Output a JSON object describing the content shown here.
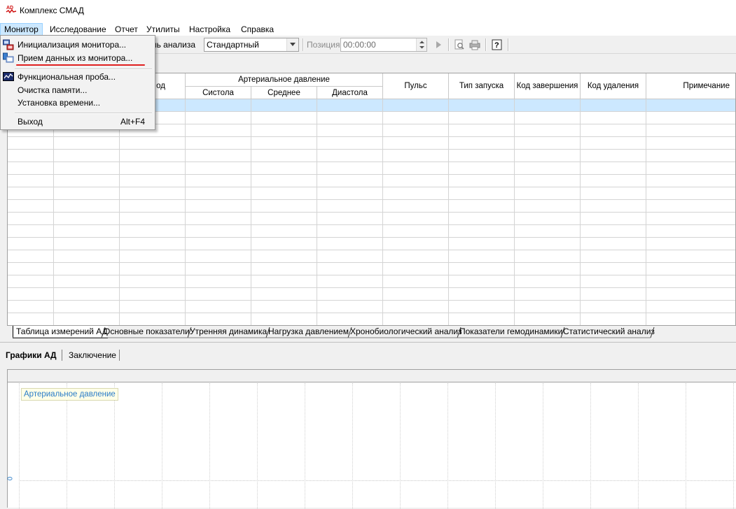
{
  "window": {
    "title": "Комплекс СМАД"
  },
  "menubar": {
    "items": [
      {
        "label": "Монитор"
      },
      {
        "label": "Исследование"
      },
      {
        "label": "Отчет"
      },
      {
        "label": "Утилиты"
      },
      {
        "label": "Настройка"
      },
      {
        "label": "Справка"
      }
    ]
  },
  "dropdown": {
    "items": [
      {
        "label": "Инициализация монитора..."
      },
      {
        "label": "Прием данных из монитора..."
      },
      {
        "label": "Функциональная проба..."
      },
      {
        "label": "Очистка памяти..."
      },
      {
        "label": "Установка времени..."
      },
      {
        "label": "Выход",
        "shortcut": "Alt+F4"
      }
    ]
  },
  "toolbar": {
    "profile_label": "филь анализа",
    "profile_value": "Стандартный",
    "position_label": "Позиция",
    "position_value": "00:00:00"
  },
  "table": {
    "headers": {
      "time_partial": "од",
      "bp_group": "Артериальное давление",
      "systole": "Систола",
      "mean": "Среднее",
      "diastole": "Диастола",
      "pulse": "Пульс",
      "start_type": "Тип запуска",
      "completion_code": "Код завершения",
      "deletion_code": "Код удаления",
      "note": "Примечание"
    }
  },
  "sheet_tabs": [
    {
      "label": "Таблица измерений АД"
    },
    {
      "label": "Основные показатели"
    },
    {
      "label": "Утренняя динамика"
    },
    {
      "label": "Нагрузка давлением"
    },
    {
      "label": "Хронобиологический анализ"
    },
    {
      "label": "Показатели гемодинамики"
    },
    {
      "label": "Статистический анализ"
    }
  ],
  "chart_tabs": [
    {
      "label": "Графики АД"
    },
    {
      "label": "Заключение"
    }
  ],
  "chart": {
    "legend": "Артериальное давление",
    "y_zero": "0"
  },
  "colors": {
    "selection": "#cce8ff",
    "accent_text": "#2a7cc8",
    "highlight_underline": "#e02020"
  }
}
